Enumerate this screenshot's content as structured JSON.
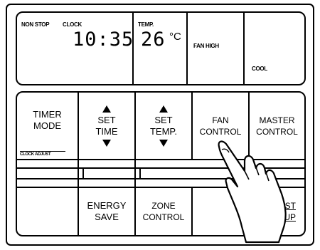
{
  "display": {
    "non_stop": "NON STOP",
    "clock_label": "CLOCK",
    "clock_value": "10:35",
    "temp_label": "TEMP.",
    "temp_value": "26",
    "temp_unit": "°C",
    "fan_speed": "FAN HIGH",
    "mode": "COOL"
  },
  "buttons": {
    "timer_mode": [
      "TIMER",
      "MODE"
    ],
    "set_time": [
      "SET",
      "TIME"
    ],
    "set_temp": [
      "SET",
      "TEMP."
    ],
    "fan_control": [
      "FAN",
      "CONTROL"
    ],
    "master_control": [
      "MASTER",
      "CONTROL"
    ],
    "clock_adjust": "CLOCK ADJUST",
    "energy_save": [
      "ENERGY",
      "SAVE"
    ],
    "zone_control": [
      "ZONE",
      "CONTROL"
    ],
    "reset_partial": [
      "ST",
      "UP"
    ]
  },
  "icons": [
    "up-arrow-icon",
    "down-arrow-icon",
    "pointing-hand-icon"
  ]
}
